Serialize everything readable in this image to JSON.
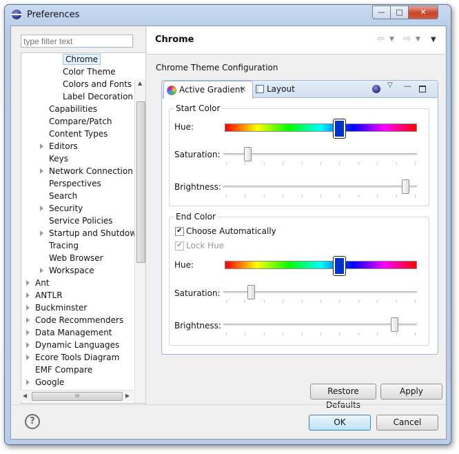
{
  "window": {
    "title": "Preferences"
  },
  "filter": {
    "placeholder": "type filter text"
  },
  "tree": {
    "items": [
      {
        "label": "Chrome",
        "selected": true
      },
      {
        "label": "Color Theme"
      },
      {
        "label": "Colors and Fonts"
      },
      {
        "label": "Label Decoration"
      },
      {
        "label": "Capabilities"
      },
      {
        "label": "Compare/Patch"
      },
      {
        "label": "Content Types"
      },
      {
        "label": "Editors",
        "expandable": true
      },
      {
        "label": "Keys"
      },
      {
        "label": "Network Connection",
        "expandable": true
      },
      {
        "label": "Perspectives"
      },
      {
        "label": "Search"
      },
      {
        "label": "Security",
        "expandable": true
      },
      {
        "label": "Service Policies"
      },
      {
        "label": "Startup and Shutdown",
        "expandable": true
      },
      {
        "label": "Tracing"
      },
      {
        "label": "Web Browser"
      },
      {
        "label": "Workspace",
        "expandable": true
      },
      {
        "label": "Ant",
        "expandable": true
      },
      {
        "label": "ANTLR",
        "expandable": true
      },
      {
        "label": "Buckminster",
        "expandable": true
      },
      {
        "label": "Code Recommenders",
        "expandable": true
      },
      {
        "label": "Data Management",
        "expandable": true
      },
      {
        "label": "Dynamic Languages",
        "expandable": true
      },
      {
        "label": "Ecore Tools Diagram",
        "expandable": true
      },
      {
        "label": "EMF Compare"
      },
      {
        "label": "Google",
        "expandable": true
      }
    ],
    "hscroll_grip": "III"
  },
  "page": {
    "title": "Chrome",
    "subtitle": "Chrome Theme Configuration"
  },
  "tabs": [
    {
      "label": "Active Gradient",
      "active": true
    },
    {
      "label": "Layout"
    }
  ],
  "start_color": {
    "group_label": "Start Color",
    "hue_label": "Hue:",
    "hue_value": 0.6,
    "saturation_label": "Saturation:",
    "saturation_value": 0.11,
    "brightness_label": "Brightness:",
    "brightness_value": 0.96
  },
  "end_color": {
    "group_label": "End Color",
    "choose_auto_label": "Choose Automatically",
    "choose_auto_checked": true,
    "lock_hue_label": "Lock Hue",
    "lock_hue_checked": true,
    "hue_label": "Hue:",
    "hue_value": 0.6,
    "saturation_label": "Saturation:",
    "saturation_value": 0.13,
    "brightness_label": "Brightness:",
    "brightness_value": 0.9
  },
  "buttons": {
    "restore_defaults": "Restore Defaults",
    "apply": "Apply",
    "ok": "OK",
    "cancel": "Cancel"
  }
}
